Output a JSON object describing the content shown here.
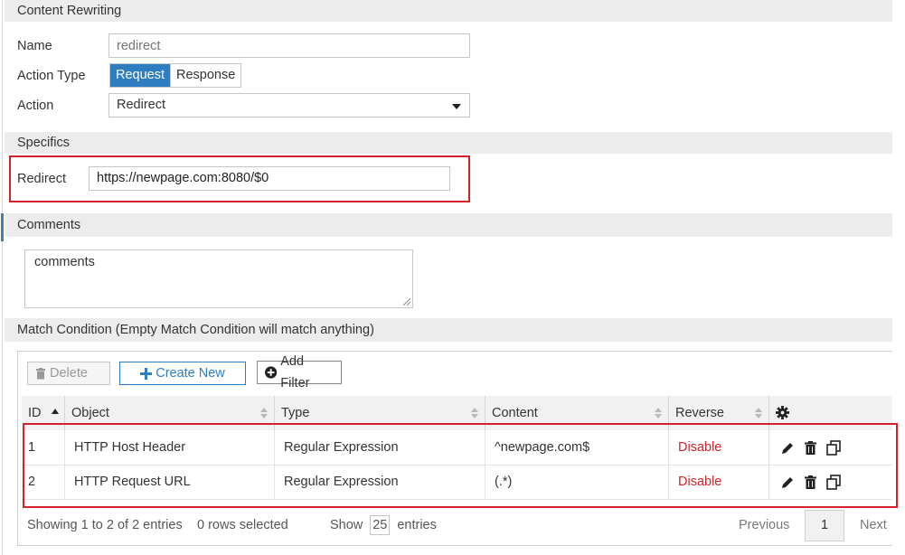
{
  "header": {
    "title": "Content Rewriting"
  },
  "form": {
    "name_label": "Name",
    "name_placeholder": "redirect",
    "action_type_label": "Action Type",
    "action_type_options": [
      "Request",
      "Response"
    ],
    "action_type_selected": "Request",
    "action_label": "Action",
    "action_value": "Redirect"
  },
  "specifics": {
    "title": "Specifics",
    "redirect_label": "Redirect",
    "redirect_value": "https://newpage.com:8080/$0"
  },
  "comments": {
    "title": "Comments",
    "value": "comments"
  },
  "match": {
    "title": "Match Condition (Empty Match Condition will match anything)",
    "toolbar": {
      "delete_label": "Delete",
      "create_label": "Create New",
      "filter_label": "Add Filter"
    },
    "columns": [
      "ID",
      "Object",
      "Type",
      "Content",
      "Reverse"
    ],
    "rows": [
      {
        "id": "1",
        "object": "HTTP Host Header",
        "type": "Regular Expression",
        "content": "^newpage.com$",
        "reverse": "Disable"
      },
      {
        "id": "2",
        "object": "HTTP Request URL",
        "type": "Regular Expression",
        "content": "(.*)",
        "reverse": "Disable"
      }
    ],
    "footer": {
      "showing": "Showing 1 to 2 of 2 entries",
      "selected": "0 rows selected",
      "show_label": "Show",
      "page_size": "25",
      "entries_label": "entries",
      "previous": "Previous",
      "page": "1",
      "next": "Next"
    }
  },
  "colors": {
    "accent": "#2f7dc1",
    "highlight_red": "#d2232a",
    "section_bg": "#ececec"
  }
}
